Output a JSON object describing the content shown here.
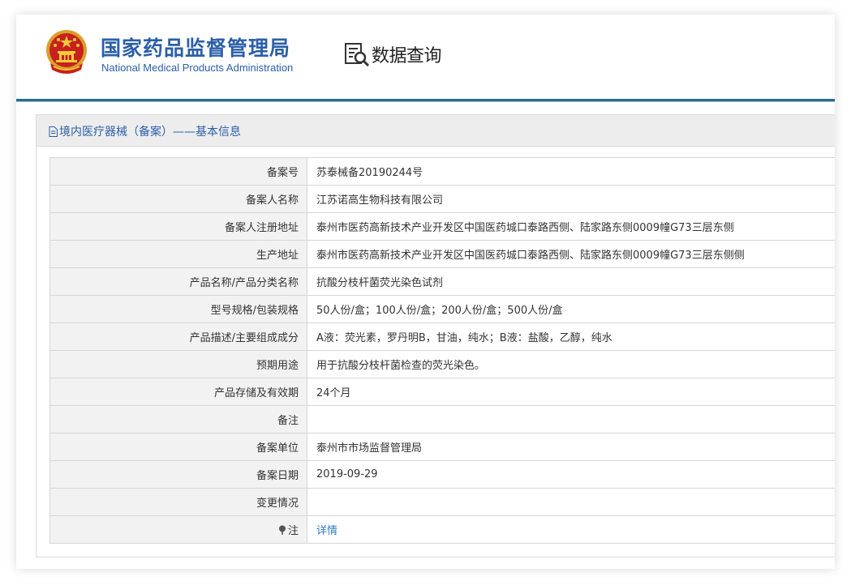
{
  "header": {
    "org_name_cn": "国家药品监督管理局",
    "org_name_en": "National Medical Products Administration",
    "query_label": "数据查询",
    "query_icon": "document-search-icon",
    "emblem_icon": "national-emblem"
  },
  "panel": {
    "title": "境内医疗器械（备案）——基本信息",
    "title_icon": "document-icon"
  },
  "rows": [
    {
      "label": "备案号",
      "value": "苏泰械备20190244号"
    },
    {
      "label": "备案人名称",
      "value": "江苏诺高生物科技有限公司"
    },
    {
      "label": "备案人注册地址",
      "value": "泰州市医药高新技术产业开发区中国医药城口泰路西侧、陆家路东侧0009幢G73三层东侧"
    },
    {
      "label": "生产地址",
      "value": "泰州市医药高新技术产业开发区中国医药城口泰路西侧、陆家路东侧0009幢G73三层东侧侧"
    },
    {
      "label": "产品名称/产品分类名称",
      "value": "抗酸分枝杆菌荧光染色试剂"
    },
    {
      "label": "型号规格/包装规格",
      "value": "50人份/盒；100人份/盒；200人份/盒；500人份/盒"
    },
    {
      "label": "产品描述/主要组成成分",
      "value": "A液：荧光素，罗丹明B，甘油，纯水；B液：盐酸，乙醇，纯水"
    },
    {
      "label": "预期用途",
      "value": "用于抗酸分枝杆菌检查的荧光染色。"
    },
    {
      "label": "产品存储及有效期",
      "value": "24个月"
    },
    {
      "label": "备注",
      "value": ""
    },
    {
      "label": "备案单位",
      "value": "泰州市市场监督管理局"
    },
    {
      "label": "备案日期",
      "value": "2019-09-29"
    },
    {
      "label": "变更情况",
      "value": ""
    }
  ],
  "note_row": {
    "label": "注",
    "icon": "pin-icon",
    "link_text": "详情"
  },
  "colors": {
    "brand_blue": "#2b5fa8",
    "link_blue": "#2b7ac2",
    "label_bg": "#f2f2f2",
    "title_bar_bg": "#ededed"
  }
}
